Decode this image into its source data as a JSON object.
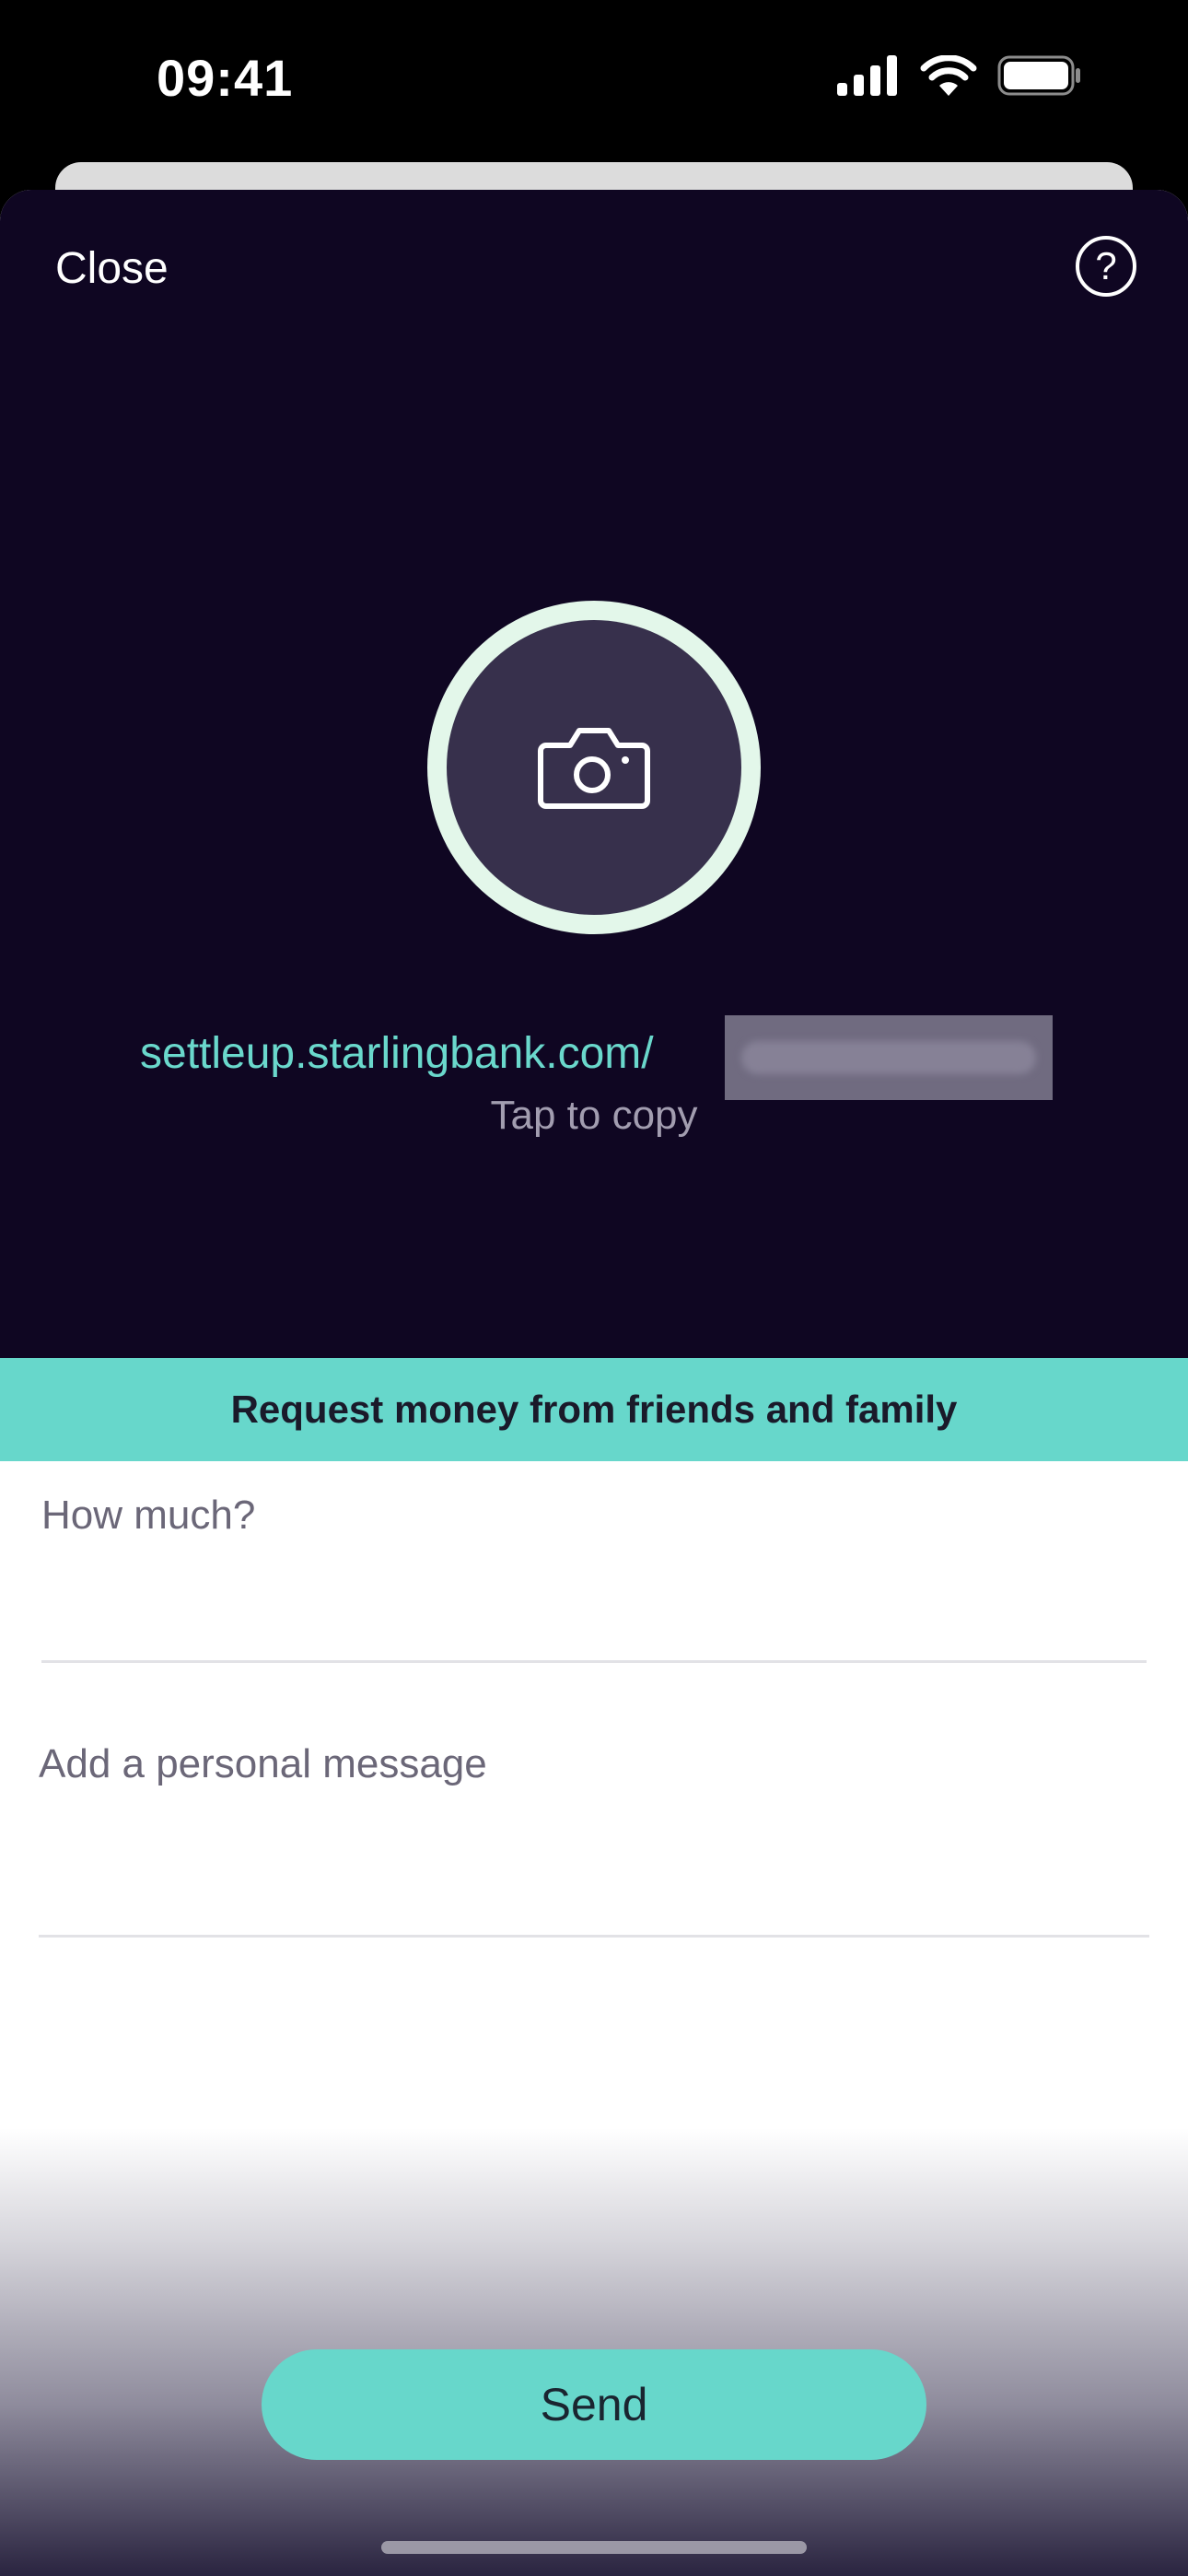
{
  "status_bar": {
    "time": "09:41",
    "icons": [
      "cellular-signal-icon",
      "wifi-icon",
      "battery-icon"
    ]
  },
  "header": {
    "close_label": "Close",
    "help_label": "?"
  },
  "profile": {
    "photo_icon": "camera-icon"
  },
  "link": {
    "url": "settleup.starlingbank.com/",
    "copy_hint": "Tap to copy"
  },
  "banner": {
    "text": "Request money from friends and family"
  },
  "form": {
    "amount_placeholder": "How much?",
    "message_placeholder": "Add a personal message"
  },
  "actions": {
    "send_label": "Send"
  },
  "colors": {
    "accent": "#67d7cb",
    "dark_background": "#0f0622",
    "avatar_ring": "#e3f7ea",
    "avatar_fill": "#37304c"
  }
}
